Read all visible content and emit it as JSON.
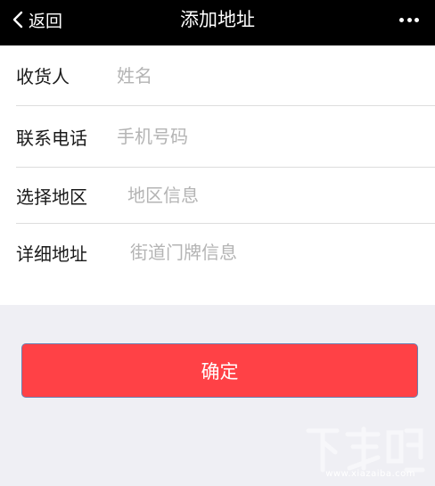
{
  "navbar": {
    "back_label": "返回",
    "title": "添加地址",
    "back_icon": "chevron-left-icon",
    "more_icon": "more-dots-icon"
  },
  "form": {
    "fields": [
      {
        "label": "收货人",
        "placeholder": "姓名",
        "value": ""
      },
      {
        "label": "联系电话",
        "placeholder": "手机号码",
        "value": ""
      },
      {
        "label": "选择地区",
        "placeholder": "地区信息",
        "value": ""
      },
      {
        "label": "详细地址",
        "placeholder": "街道门牌信息",
        "value": ""
      }
    ]
  },
  "confirm_button": {
    "label": "确定"
  },
  "watermark": {
    "logo_text": "下载吧",
    "url": "www.xiazaiba.com"
  },
  "colors": {
    "navbar_bg": "#000000",
    "page_bg": "#efeff4",
    "accent_red": "#ff4146",
    "placeholder": "#b4b4b4"
  }
}
